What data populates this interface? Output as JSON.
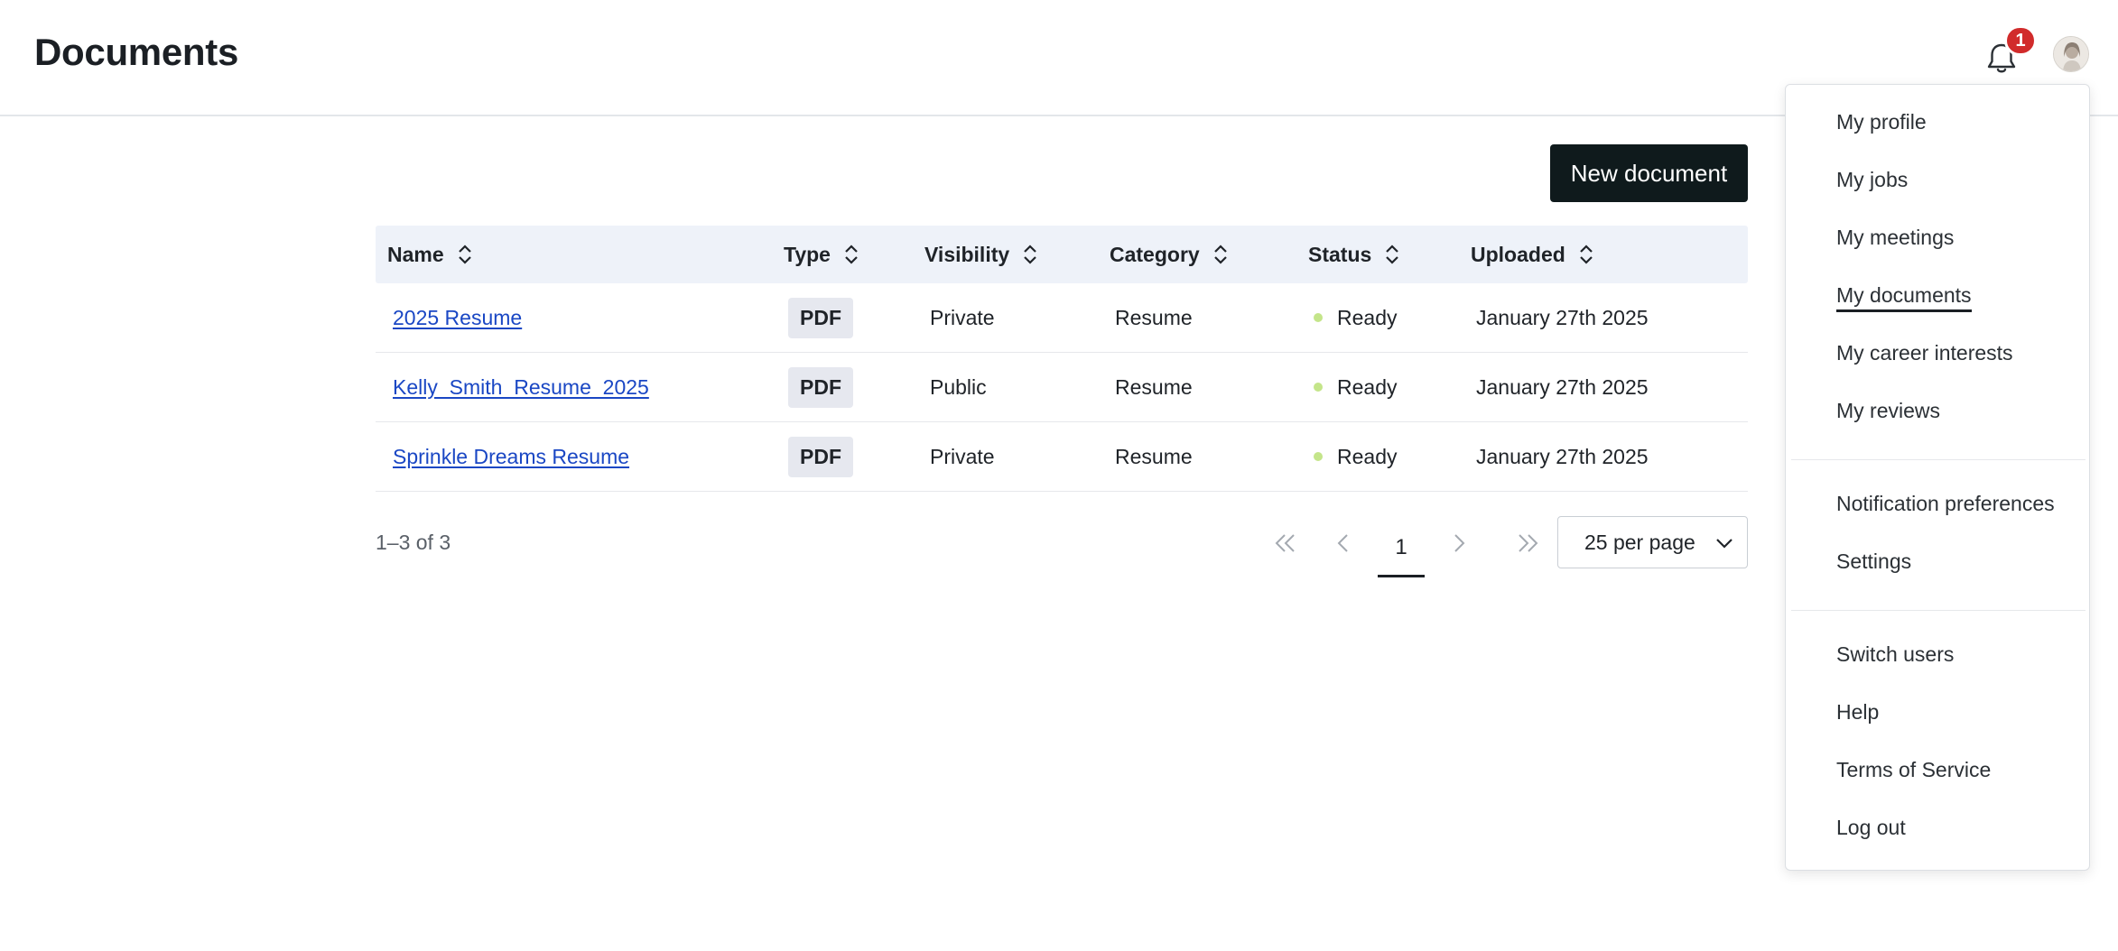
{
  "header": {
    "title": "Documents",
    "notification_count": "1"
  },
  "actions": {
    "new_document": "New document"
  },
  "table": {
    "columns": [
      "Name",
      "Type",
      "Visibility",
      "Category",
      "Status",
      "Uploaded"
    ],
    "rows": [
      {
        "name": "2025 Resume",
        "type": "PDF",
        "visibility": "Private",
        "category": "Resume",
        "status": "Ready",
        "uploaded": "January 27th 2025"
      },
      {
        "name": "Kelly_Smith_Resume_2025",
        "type": "PDF",
        "visibility": "Public",
        "category": "Resume",
        "status": "Ready",
        "uploaded": "January 27th 2025"
      },
      {
        "name": "Sprinkle Dreams Resume",
        "type": "PDF",
        "visibility": "Private",
        "category": "Resume",
        "status": "Ready",
        "uploaded": "January 27th 2025"
      }
    ]
  },
  "pagination": {
    "range": "1–3 of 3",
    "current_page": "1",
    "per_page": "25 per page"
  },
  "menu": {
    "items": [
      "My profile",
      "My jobs",
      "My meetings",
      "My documents",
      "My career interests",
      "My reviews",
      "Notification preferences",
      "Settings",
      "Switch users",
      "Help",
      "Terms of Service",
      "Log out"
    ],
    "active": "My documents"
  },
  "colors": {
    "primary_button": "#0f1a1c",
    "link": "#1a47c4",
    "badge": "#d12b2b",
    "status_ready": "#c4e58a",
    "table_header": "#eef2f9"
  }
}
